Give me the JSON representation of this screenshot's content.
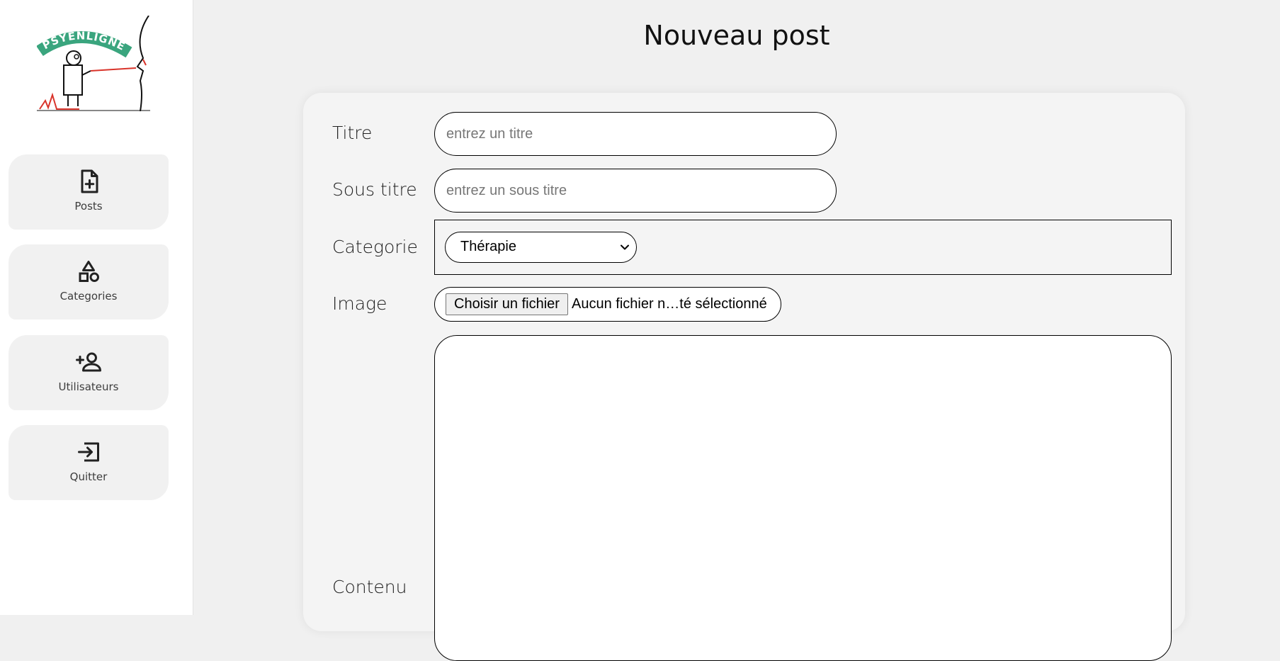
{
  "app": {
    "logo_text": "PSYENLIGNE"
  },
  "sidebar": {
    "items": [
      {
        "label": "Posts",
        "icon": "file-plus-icon"
      },
      {
        "label": "Categories",
        "icon": "shapes-icon"
      },
      {
        "label": "Utilisateurs",
        "icon": "user-plus-icon"
      },
      {
        "label": "Quitter",
        "icon": "logout-icon"
      }
    ]
  },
  "page": {
    "title": "Nouveau post"
  },
  "form": {
    "title_label": "Titre",
    "title_placeholder": "entrez un titre",
    "title_value": "",
    "subtitle_label": "Sous titre",
    "subtitle_placeholder": "entrez un sous titre",
    "subtitle_value": "",
    "category_label": "Categorie",
    "category_selected": "Thérapie",
    "image_label": "Image",
    "file_button_label": "Choisir un fichier",
    "file_status": "Aucun fichier n…té sélectionné",
    "content_label": "Contenu",
    "content_value": ""
  },
  "colors": {
    "page_bg": "#f0f0f0",
    "sidebar_bg": "#ffffff",
    "nav_item_bg": "#f1f1f1",
    "card_bg": "#f4f4f4",
    "logo_green": "#3aa57e",
    "logo_red": "#d9342b"
  }
}
